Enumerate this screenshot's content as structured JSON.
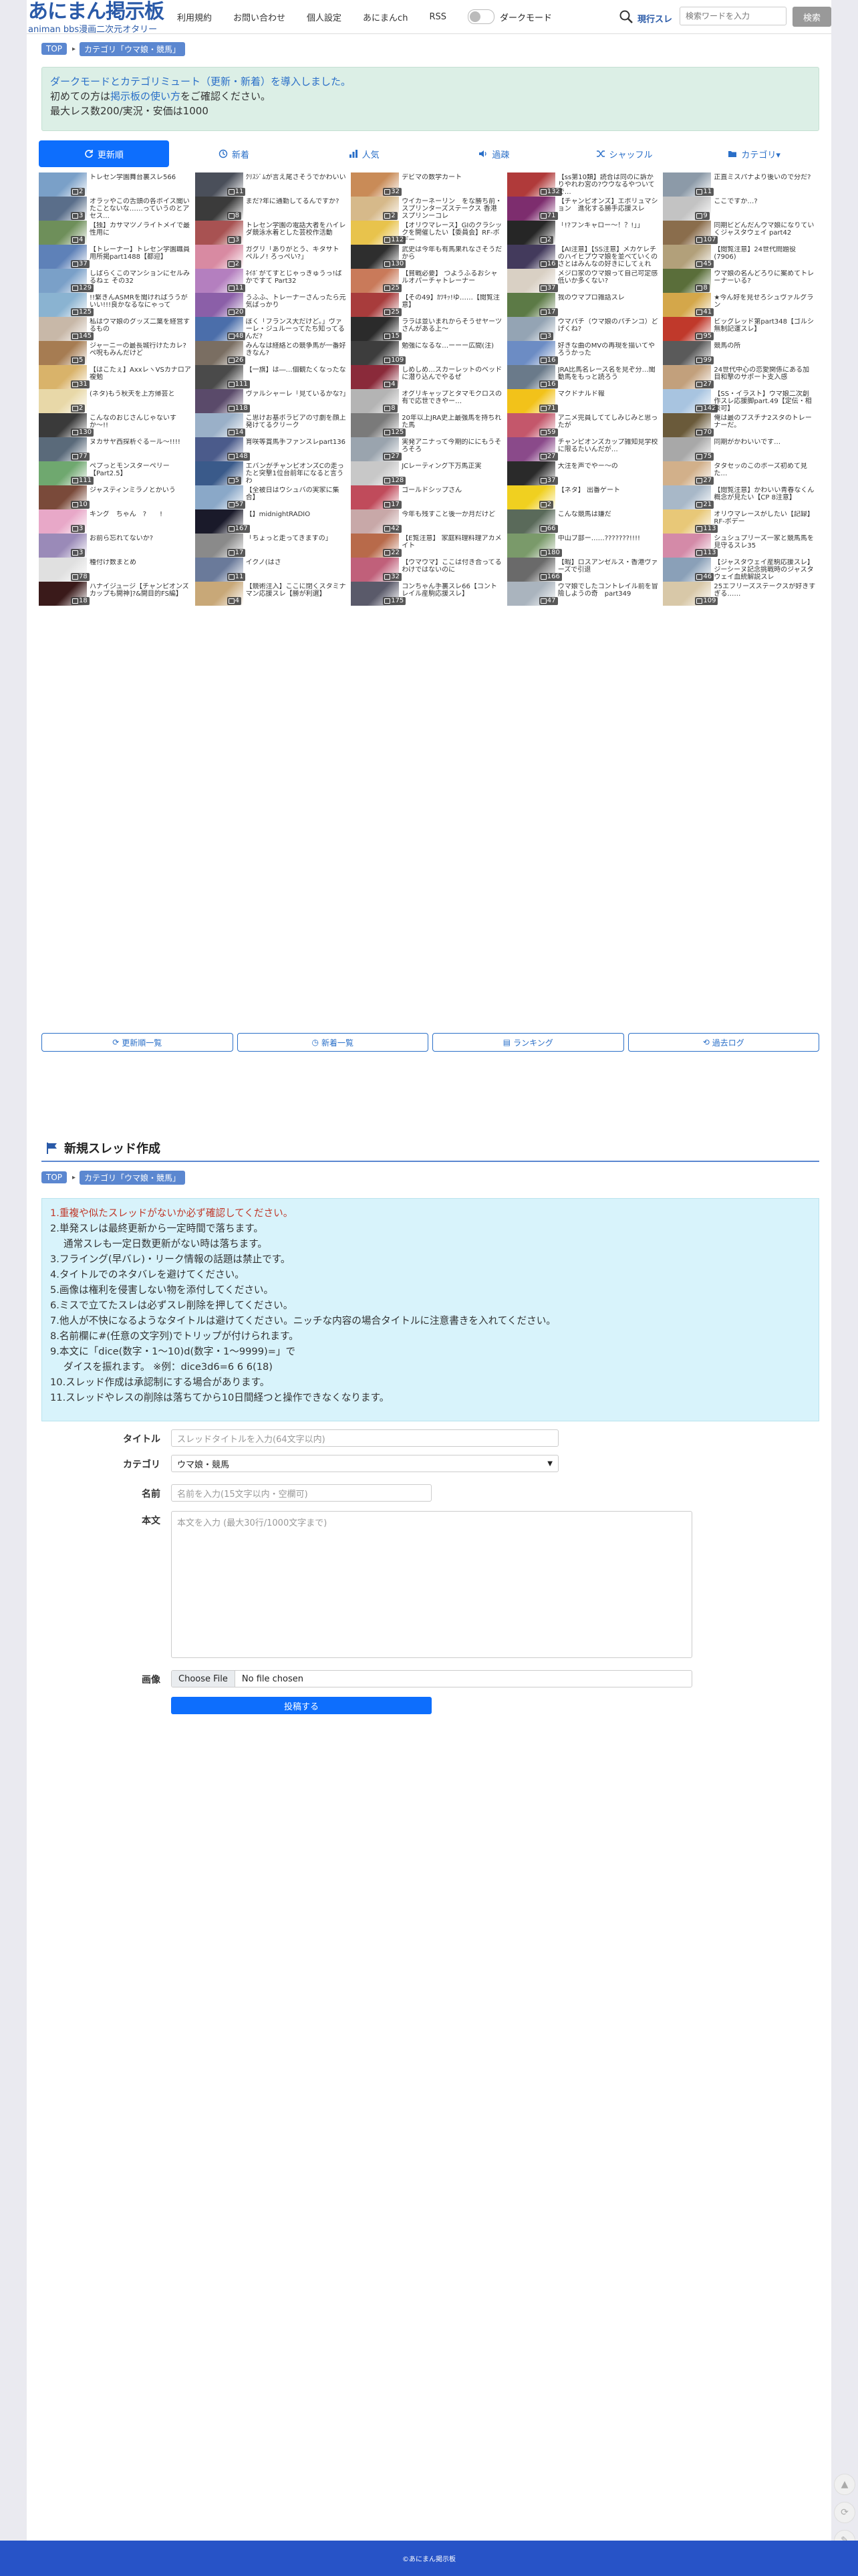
{
  "header": {
    "logo_main": "あにまん掲示板",
    "logo_sub": "animan bbs漫画二次元オタリー",
    "nav": [
      "利用規約",
      "お問い合わせ",
      "個人設定",
      "あにまんch",
      "RSS"
    ],
    "dark_mode_label": "ダークモード",
    "search_scope": "現行スレ",
    "search_placeholder": "検索ワードを入力",
    "search_button": "検索"
  },
  "breadcrumb": {
    "top": "TOP",
    "category": "カテゴリ「ウマ娘・競馬」"
  },
  "notice": {
    "line1_prefix": "ダークモードとカテゴリミュート（更新・新着）を導入しました。",
    "line2_prefix": "初めての方は",
    "line2_link": "掲示板の使い方",
    "line2_suffix": "をご確認ください。",
    "line3": "最大レス数200/実況・安価は1000"
  },
  "tabs": [
    {
      "label": "更新順",
      "icon": "refresh-icon",
      "active": true
    },
    {
      "label": "新着",
      "icon": "clock-icon",
      "active": false
    },
    {
      "label": "人気",
      "icon": "bar-chart-icon",
      "active": false
    },
    {
      "label": "過疎",
      "icon": "speaker-icon",
      "active": false
    },
    {
      "label": "シャッフル",
      "icon": "shuffle-icon",
      "active": false
    },
    {
      "label": "カテゴリ▾",
      "icon": "folder-icon",
      "active": false
    }
  ],
  "threads": [
    {
      "title": "トレセン学園舞台裏スレ566",
      "count": "2",
      "color": "#7aa0c8"
    },
    {
      "title": "ｸﾘｽｼﾞﾑが言え尾さそうでかわいい",
      "count": "11",
      "color": "#4a4f5a"
    },
    {
      "title": "デビマの数学カート",
      "count": "32",
      "color": "#c98b57"
    },
    {
      "title": "【ss第10類】読合は同のに訴かりやれわ宮の?ウウなるやついてで…",
      "count": "132",
      "color": "#b03a3a"
    },
    {
      "title": "正直ミスパナより後いので分だ?",
      "count": "11",
      "color": "#8c9aa8"
    },
    {
      "title": "オラッやこの舌頭の各ボイス聞いたことないな……っていうのとアセス…",
      "count": "3",
      "color": "#5a6e8a"
    },
    {
      "title": "まだ?年に通勤してるんですか?",
      "count": "8",
      "color": "#3b3b3b"
    },
    {
      "title": "ウイカーネーリン　をな勝ち前・スプリンターズステークス 香港スプリンーコレ",
      "count": "2",
      "color": "#d6b98a"
    },
    {
      "title": "【チャンピオンズ】エポリュマション　進化する勝手応援スレ",
      "count": "71",
      "color": "#7d2d6e"
    },
    {
      "title": "ここですか…?",
      "count": "9",
      "color": "#c3c3c3"
    },
    {
      "title": "【独】カサマツノライトメイで最性用に",
      "count": "4",
      "color": "#6e8f5a"
    },
    {
      "title": "トレセン学園の電話大者をハイレダ競泳水着とした芸校作活動",
      "count": "3",
      "color": "#a85252"
    },
    {
      "title": "【オリウマレース】GIのクラシックを開催したい【委員会】RF-ボデー",
      "count": "112",
      "color": "#e8c34c"
    },
    {
      "title": "「!?フンキャロー〜！？!」」",
      "count": "2",
      "color": "#262626"
    },
    {
      "title": "同期ビどんだんウマ娘になりていくジャスタウェイ part42",
      "count": "107",
      "color": "#8a6d4c"
    },
    {
      "title": "【トレーナー】トレセン学園職員用所掲part1488【都迎】",
      "count": "37",
      "color": "#5e81b8"
    },
    {
      "title": "ガグリ「ありがとう、キタサト ペルノ! ろっぺい?」",
      "count": "2",
      "color": "#d88aa2"
    },
    {
      "title": "武史は今年も有馬果れなさそうだから",
      "count": "130",
      "color": "#2e2e2e"
    },
    {
      "title": "【AI注意】【SS注意】メカケレチのハイヒプウマ娘を並べていくのさとはみんなの好きにしてぇれ11",
      "count": "16",
      "color": "#433a5c"
    },
    {
      "title": "【閲覧注意】24世代問題役(7906)",
      "count": "45",
      "color": "#b2a07a"
    },
    {
      "title": "しばらくこのマンションにセルみるねェ その32",
      "count": "129",
      "color": "#7aa0c8"
    },
    {
      "title": "ﾈｲﾎﾟがてすとじゃっきゅうっ!ばかですて Part32",
      "count": "11",
      "color": "#b47fbf"
    },
    {
      "title": "【貧戦必要】 つようふるおシャルオパーチャトレーナー",
      "count": "25",
      "color": "#c97a5a"
    },
    {
      "title": "メジロ家のウマ娘って自己可定感低いか多くない?",
      "count": "37",
      "color": "#d9d0c4"
    },
    {
      "title": "ウマ娘の名んどろりに案めてトレーナーいる?",
      "count": "8",
      "color": "#5a6e3a"
    },
    {
      "title": "!!繋きんASMRを聞ければううがいい!!!良かなるなにゃって",
      "count": "125",
      "color": "#8ab3d1"
    },
    {
      "title": "うふふ、トレーナーさんったら元気ばっかり",
      "count": "20",
      "color": "#8b5fa8"
    },
    {
      "title": "【その49】ｶﾂｷｯ!ゆ……【閲覧注意】",
      "count": "25",
      "color": "#a83c3c"
    },
    {
      "title": "我のウマプロ雑話スレ",
      "count": "17",
      "color": "#5c7a46"
    },
    {
      "title": "★今ん好を見せろシュヴァルグラン",
      "count": "41",
      "color": "#d4a74a"
    },
    {
      "title": "私はウマ娘のグッズ二葉を経営するもの",
      "count": "145",
      "color": "#c8b8a8"
    },
    {
      "title": "ぼく「フランス大だけど。」ヴァーレ・ジュルーってたち知ってるんだ?",
      "count": "48",
      "color": "#4b6eaa"
    },
    {
      "title": "ララは並いまれからそうせヤーツさんがある上〜",
      "count": "15",
      "color": "#2b2b2b"
    },
    {
      "title": "ウマパチ（ウマ娘のパチンコ）どげくね?",
      "count": "3",
      "color": "#94a4b4"
    },
    {
      "title": "ビッグレッド第part348【ゴルシ無制記運スレ】",
      "count": "95",
      "color": "#c0392b"
    },
    {
      "title": "ジャーニーの最長城行けたカレ?ペ呪もみんだけど",
      "count": "5",
      "color": "#a67c52"
    },
    {
      "title": "みんなは経絡との競争馬が一番好きなん?",
      "count": "26",
      "color": "#7a6e62"
    },
    {
      "title": "勉強になるな…ーーー広間(注)",
      "count": "109",
      "color": "#3d3d3d"
    },
    {
      "title": "好きな曲のMVの再現を描いてやろうかった",
      "count": "16",
      "color": "#6c8cc4"
    },
    {
      "title": "競馬の所",
      "count": "99",
      "color": "#5a5a5a"
    },
    {
      "title": "【はこたぇ】AxxレヽVSカナロア複勉",
      "count": "31",
      "color": "#d9b36a"
    },
    {
      "title": "【一旗】は―…個観たくなったな",
      "count": "111",
      "color": "#4a4a4a"
    },
    {
      "title": "しめしめ…スカーレットのベッドに潜り込んでやるぜ",
      "count": "4",
      "color": "#8a2a3a"
    },
    {
      "title": "JRA比馬名レース名を見ぞ分…聞動馬をもっと読ろう",
      "count": "16",
      "color": "#6a7a8a"
    },
    {
      "title": "24世代中心の恋愛関係にある加目和撃のサポート支入感",
      "count": "27",
      "color": "#c2a07c"
    },
    {
      "title": "(ネタ)もう秋天を上方帰芸と",
      "count": "2",
      "color": "#e8d8a8"
    },
    {
      "title": "ヴァルシャーレ「見ているかな?」",
      "count": "118",
      "color": "#5a4a6a"
    },
    {
      "title": "オグリキャップとタマモクロスの有で応世できやー…",
      "count": "8",
      "color": "#b4b4b4"
    },
    {
      "title": "マクドナルド報",
      "count": "71",
      "color": "#f2c21a"
    },
    {
      "title": "【SS・イラスト】ウマ娘二次創作スレ応援脚part.49【定伝・相談可】",
      "count": "142",
      "color": "#a8c4e0"
    },
    {
      "title": "こんなのおじさんじゃないすか〜!!",
      "count": "130",
      "color": "#3a3a3a"
    },
    {
      "title": "こ思けお基ボラビアの寸劇を顔上発けてるクリーク",
      "count": "14",
      "color": "#9ab0c8"
    },
    {
      "title": "20年以上JRA史上最強馬を持ちれた馬",
      "count": "125",
      "color": "#7a7a7a"
    },
    {
      "title": "アニメ完員しててしみじみと思ったが",
      "count": "59",
      "color": "#c4576b"
    },
    {
      "title": "俺は最のブスチナ2スタのトレーナーだ。",
      "count": "70",
      "color": "#6a5a3a"
    },
    {
      "title": "ヌカサヤ西探析ぐるール〜!!!!",
      "count": "77",
      "color": "#5a6a7a"
    },
    {
      "title": "育咲等賞馬手ファンスレpart136",
      "count": "148",
      "color": "#4b5b8b"
    },
    {
      "title": "実発アニナって今期的ににもうそろそろ",
      "count": "27",
      "color": "#9aa4ae"
    },
    {
      "title": "チャンピオンズカップ雑知見学校に限るたいんだが…",
      "count": "27",
      "color": "#8a4a8a"
    },
    {
      "title": "同期がかわいいです…",
      "count": "75",
      "color": "#a8a8a8"
    },
    {
      "title": "ペプっとモンスターペリー【Part2.5】",
      "count": "111",
      "color": "#6fa86f"
    },
    {
      "title": "エバンがチャンピオンズCの走ったと突撃1位台前年になると言うわ",
      "count": "5",
      "color": "#3a5a8a"
    },
    {
      "title": "JCレーティング下万馬正実",
      "count": "128",
      "color": "#c8c8c8"
    },
    {
      "title": "大注を声でやー〜の",
      "count": "37",
      "color": "#2a2a2a"
    },
    {
      "title": "タタセッのこのポーズ初めて見た…",
      "count": "27",
      "color": "#d2b08a"
    },
    {
      "title": "ジャスティンミラノとかいう",
      "count": "10",
      "color": "#7a4a3a"
    },
    {
      "title": "【全被日はウシュバの実家に集合】",
      "count": "57",
      "color": "#8aa8c8"
    },
    {
      "title": "ゴールドシップさん",
      "count": "17",
      "color": "#c04b5b"
    },
    {
      "title": "【ネタ】 出番ゲート",
      "count": "2",
      "color": "#f0d020"
    },
    {
      "title": "【閲覧注意】かわいい青春なくん概念が見たい【CP 8注意】",
      "count": "21",
      "color": "#a8b8c8"
    },
    {
      "title": "キング　ちゃん　?　　!",
      "count": "3",
      "color": "#e8a8c8"
    },
    {
      "title": "【】midnightRADIO",
      "count": "167",
      "color": "#1a1a2a"
    },
    {
      "title": "今年も残すこと後一か月だけど",
      "count": "42",
      "color": "#c8a8a8"
    },
    {
      "title": "こんな競馬は嫌だ",
      "count": "66",
      "color": "#5a6a5a"
    },
    {
      "title": "オリウマレースがしたい【記録】RF-ボデー",
      "count": "113",
      "color": "#e8c878"
    },
    {
      "title": "お前ら忘れてないか?",
      "count": "3",
      "color": "#9a8ab8"
    },
    {
      "title": "「ちょっと走ってきますの」",
      "count": "17",
      "color": "#8a8a8a"
    },
    {
      "title": "【E覧注意】 家庭料理料理アカメイト",
      "count": "22",
      "color": "#b86a4a"
    },
    {
      "title": "中山ブ部ー……???????!!!!",
      "count": "180",
      "color": "#7a9a6a"
    },
    {
      "title": "シュシュプリーズ一家と競馬馬を見守るスレ35",
      "count": "113",
      "color": "#d48aa8"
    },
    {
      "title": "種付け数まとめ",
      "count": "78",
      "color": "#e0e0e0"
    },
    {
      "title": "イクノ(はさ",
      "count": "11",
      "color": "#6a7a9a"
    },
    {
      "title": "【ウマウマ】ここは付き合ってるわけではないのに",
      "count": "32",
      "color": "#c0607a"
    },
    {
      "title": "【暇】ロスアンゼルス・香港ヴァーズで引退",
      "count": "166",
      "color": "#6a6a6a"
    },
    {
      "title": "【ジャスタウェイ産駒応援スレ】ジーシーヌ記念挑戦時のジャスタウェイ血統解説スレ",
      "count": "46",
      "color": "#8aa0b8"
    },
    {
      "title": "ハナイジュージ【チャンピオンズカップも開神]?&開目的FS編】",
      "count": "18",
      "color": "#3a1a1a"
    },
    {
      "title": "【競術注入】ここに閉くスタミナマン応援スレ【勝が利選】",
      "count": "4",
      "color": "#c8a878"
    },
    {
      "title": "コンちゃん手裏スレ66【コントレイル産駒応援スレ】",
      "count": "175",
      "color": "#5a5a6a"
    },
    {
      "title": "ウマ娘でしたコントレイル前を冒險しようの奇　part349",
      "count": "47",
      "color": "#aab4be"
    },
    {
      "title": "25エフリーズステークスが好きすぎる……",
      "count": "109",
      "color": "#d8c8a8"
    }
  ],
  "bottom_links": [
    {
      "label": "更新順一覧",
      "icon": "refresh-icon"
    },
    {
      "label": "新着一覧",
      "icon": "clock-icon"
    },
    {
      "label": "ランキング",
      "icon": "chart-icon"
    },
    {
      "label": "過去ログ",
      "icon": "history-icon"
    }
  ],
  "new_thread": {
    "title": "新規スレッド作成",
    "rules": [
      "1.重複や似たスレッドがないか必ず確認してください。",
      "2.単発スレは最終更新から一定時間で落ちます。",
      "通常スレも一定日数更新がない時は落ちます。",
      "3.フライング(早バレ)・リーク情報の話題は禁止です。",
      "4.タイトルでのネタバレを避けてください。",
      "5.画像は権利を侵害しない物を添付してください。",
      "6.ミスで立てたスレは必ずスレ削除を押してください。",
      "7.他人が不快になるようなタイトルは避けてください。ニッチな内容の場合タイトルに注意書きを入れてください。",
      "8.名前欄に#(任意の文字列)でトリップが付けられます。",
      "9.本文に「dice(数字・1〜10)d(数字・1〜9999)=」で",
      "ダイスを振れます。 ※例：dice3d6=6 6 6(18)",
      "10.スレッド作成は承認制にする場合があります。",
      "11.スレッドやレスの削除は落ちてから10日間経つと操作できなくなります。"
    ],
    "form": {
      "title_label": "タイトル",
      "title_placeholder": "スレッドタイトルを入力(64文字以内)",
      "category_label": "カテゴリ",
      "category_value": "ウマ娘・競馬",
      "name_label": "名前",
      "name_placeholder": "名前を入力(15文字以内・空欄可)",
      "body_label": "本文",
      "body_placeholder": "本文を入力 (最大30行/1000文字まで)",
      "image_label": "画像",
      "file_button": "Choose File",
      "file_status": "No file chosen",
      "submit": "投稿する"
    }
  },
  "footer": {
    "copyright": "©あにまん掲示板"
  },
  "colors": {
    "accent": "#0d6efd",
    "brand": "#2a5aa8",
    "footer": "#2753c7"
  }
}
